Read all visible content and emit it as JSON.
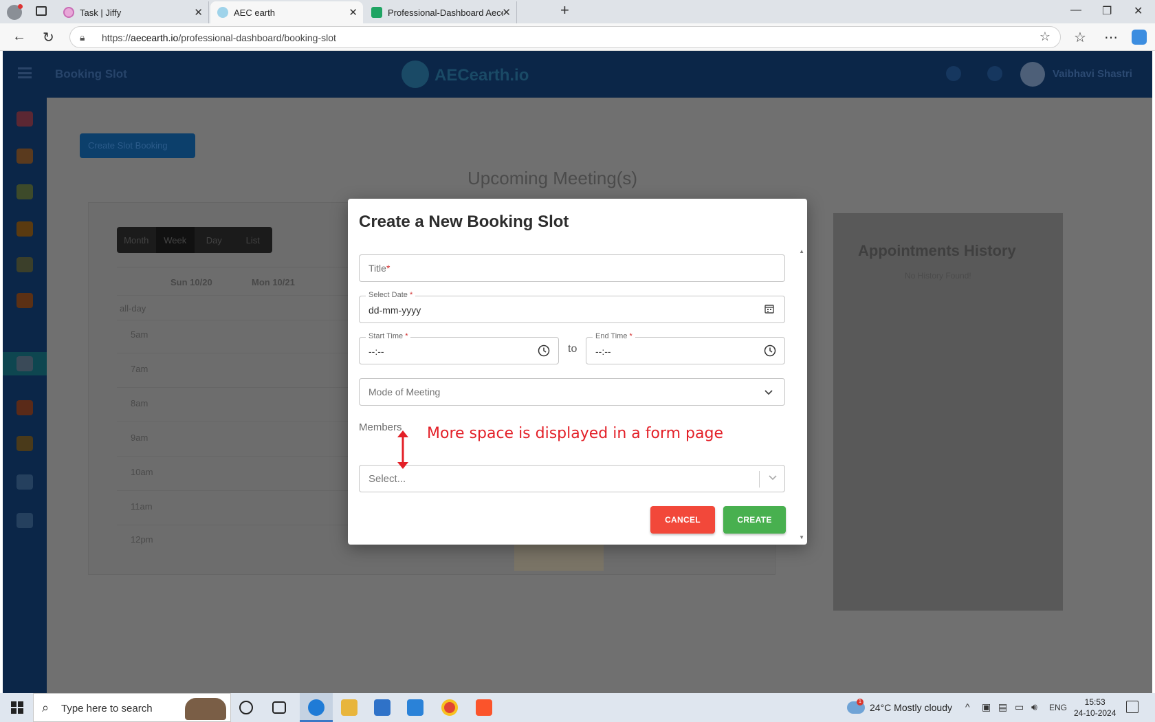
{
  "browser": {
    "tabs": [
      {
        "title": "Task | Jiffy"
      },
      {
        "title": "AEC earth"
      },
      {
        "title": "Professional-Dashboard Aecearth"
      }
    ],
    "url_prefix": "https://",
    "url_host": "aecearth.io",
    "url_path": "/professional-dashboard/booking-slot"
  },
  "app": {
    "page_title": "Booking Slot",
    "logo_text": "AECearth.io",
    "user_name": "Vaibhavi Shastri",
    "create_slot_button": "Create Slot Booking",
    "upcoming_title": "Upcoming Meeting(s)",
    "calendar": {
      "view_tabs": [
        "Month",
        "Week",
        "Day",
        "List"
      ],
      "day_headers": [
        "Sun 10/20",
        "Mon 10/21"
      ],
      "all_day_label": "all-day",
      "time_labels": [
        "5am",
        "7am",
        "8am",
        "9am",
        "10am",
        "11am",
        "12pm"
      ]
    },
    "history": {
      "title": "Appointments History",
      "subtitle": "No History Found!"
    }
  },
  "modal": {
    "title": "Create a New Booking Slot",
    "title_field": {
      "placeholder": "Title",
      "required_mark": "*"
    },
    "date_field": {
      "label": "Select Date",
      "value": "dd-mm-yyyy",
      "required_mark": "*"
    },
    "start_time": {
      "label": "Start Time",
      "value": "--:--",
      "required_mark": "*"
    },
    "end_time": {
      "label": "End Time",
      "value": "--:--",
      "required_mark": "*"
    },
    "to_label": "to",
    "mode_field": {
      "placeholder": "Mode of Meeting"
    },
    "members_label": "Members",
    "members_select": {
      "placeholder": "Select..."
    },
    "cancel_button": "CANCEL",
    "create_button": "CREATE"
  },
  "annotation": {
    "text": "More space is displayed in a form page",
    "color": "#e32028"
  },
  "taskbar": {
    "search_placeholder": "Type here to search",
    "weather": "24°C  Mostly cloudy",
    "weather_badge": "1",
    "language": "ENG",
    "time": "15:53",
    "date": "24-10-2024"
  },
  "colors": {
    "cancel": "#f2483a",
    "create": "#48b04f",
    "header": "#0b2648"
  }
}
